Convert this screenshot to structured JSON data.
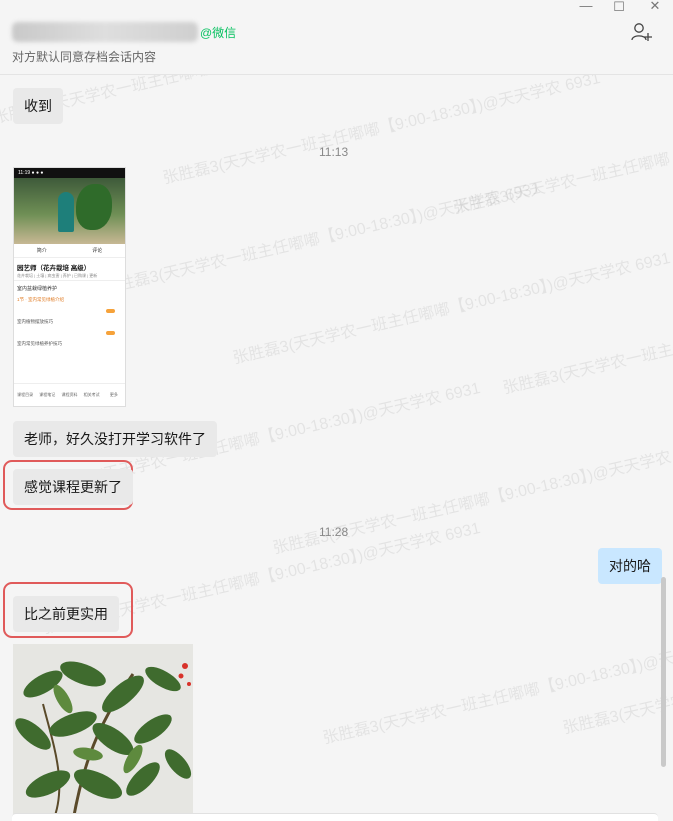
{
  "header": {
    "wechat_tag": "@微信",
    "consent_note": "对方默认同意存档会话内容",
    "window_controls": {
      "minimize": "—",
      "maximize": "☐",
      "close": "✕"
    },
    "add_member_icon": "add-user-icon"
  },
  "messages": {
    "m1": "收到",
    "time1": "11:13",
    "m2": "老师，好久没打开学习软件了",
    "m3": "感觉课程更新了",
    "time2": "11:28",
    "m4": "对的哈",
    "m5": "比之前更实用"
  },
  "phone_screenshot": {
    "status": "11:19 ● ● ●",
    "tab_a": "简介",
    "tab_b": "评论",
    "course_title": "园艺师（花卉栽培 高级）",
    "course_meta": "花卉栽培 | 土壤 | 病虫害 | 养护 | 已购课 | 更新",
    "section": "室内盆栽绿植养护",
    "rows": [
      "1节 · 室内常见绿植介绍",
      "室内植物摆放技巧",
      "室内常见绿植养护技巧"
    ],
    "bar": [
      "课程目录",
      "课程笔记",
      "课程资料",
      "相关考试",
      "更多"
    ]
  },
  "watermark_text": "张胜磊3(天天学农一班主任嘟嘟【9:00-18:30】)@天天学农 6931",
  "colors": {
    "bubble_other": "#e9e9e9",
    "bubble_mine": "#c9e7ff",
    "highlight": "#e05a5a",
    "wx_green": "#07c160"
  }
}
